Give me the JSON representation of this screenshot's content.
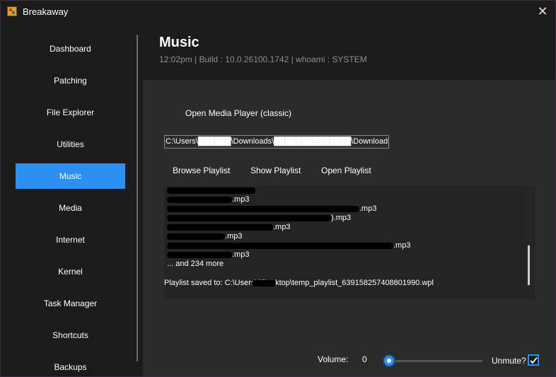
{
  "window": {
    "title": "Breakaway",
    "app_icon": "app-logo-icon",
    "close_icon": "close-icon",
    "close_glyph": "✕"
  },
  "sidebar": {
    "items": [
      {
        "label": "Dashboard"
      },
      {
        "label": "Patching"
      },
      {
        "label": "File Explorer"
      },
      {
        "label": "Utilities"
      },
      {
        "label": "Music",
        "active": true
      },
      {
        "label": "Media"
      },
      {
        "label": "Internet"
      },
      {
        "label": "Kernel"
      },
      {
        "label": "Task Manager"
      },
      {
        "label": "Shortcuts"
      },
      {
        "label": "Backups"
      }
    ]
  },
  "header": {
    "title": "Music",
    "subtitle": "12:02pm | Build : 10.0.26100.1742 | whoami : SYSTEM"
  },
  "music": {
    "open_media_player": "Open Media Player (classic)",
    "path_value": "C:\\Users\\██████\\Downloads\\██████████████\\Downloads",
    "browse_playlist": "Browse Playlist",
    "show_playlist": "Show Playlist",
    "open_playlist": "Open Playlist",
    "output": {
      "lines": [
        ".mp3",
        ".mp3",
        ").mp3",
        ".mp3",
        ".mp3",
        ".mp3",
        ".mp3"
      ],
      "more": "... and 234 more",
      "saved": "Playlist saved to: C:\\Users\\      \\Desktop\\temp_playlist_639158257408801990.wpl"
    },
    "volume_label": "Volume:",
    "volume_value": "0",
    "unmute_label": "Unmute?",
    "unmute_checked": true
  },
  "colors": {
    "accent": "#2c8ff2",
    "background": "#1b1b1b",
    "panel": "#2b2b2b"
  }
}
